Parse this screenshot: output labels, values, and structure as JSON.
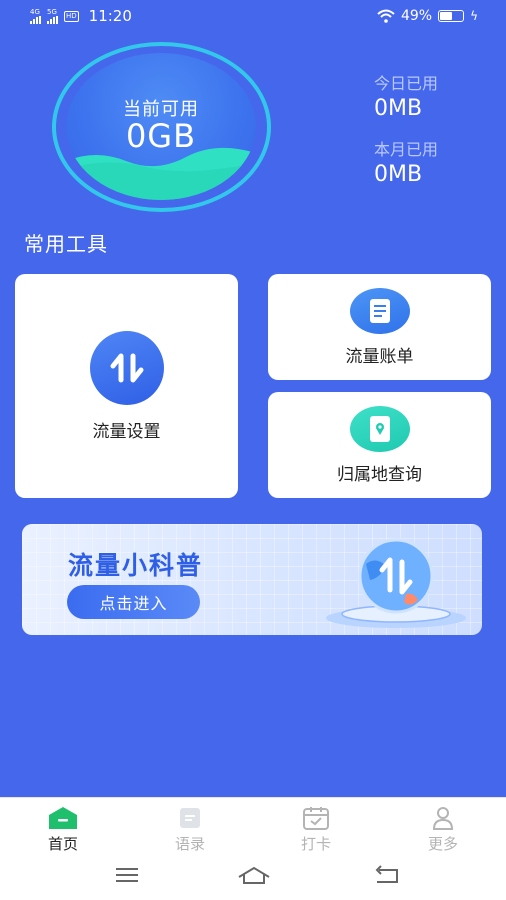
{
  "status_bar": {
    "net1": "4G",
    "net2": "5G",
    "hd": "HD",
    "time": "11:20",
    "battery": "49%",
    "battery_level": 0.49
  },
  "gauge": {
    "label": "当前可用",
    "value": "0GB"
  },
  "usage": {
    "today_label": "今日已用",
    "today_value": "0MB",
    "month_label": "本月已用",
    "month_value": "0MB"
  },
  "tools": {
    "title": "常用工具",
    "items": [
      {
        "label": "流量设置",
        "icon": "data-transfer-icon"
      },
      {
        "label": "流量账单",
        "icon": "bill-icon"
      },
      {
        "label": "归属地查询",
        "icon": "location-phone-icon"
      }
    ]
  },
  "banner": {
    "title": "流量小科普",
    "button": "点击进入"
  },
  "bottom_nav": {
    "tabs": [
      {
        "label": "首页",
        "icon": "home-icon",
        "active": true
      },
      {
        "label": "语录",
        "icon": "notes-icon",
        "active": false
      },
      {
        "label": "打卡",
        "icon": "calendar-check-icon",
        "active": false
      },
      {
        "label": "更多",
        "icon": "user-icon",
        "active": false
      }
    ]
  },
  "colors": {
    "background": "#4467ec",
    "accent": "#2f5fe6",
    "wave": "#2fe0c3",
    "active_tab": "#1fbf6e"
  }
}
